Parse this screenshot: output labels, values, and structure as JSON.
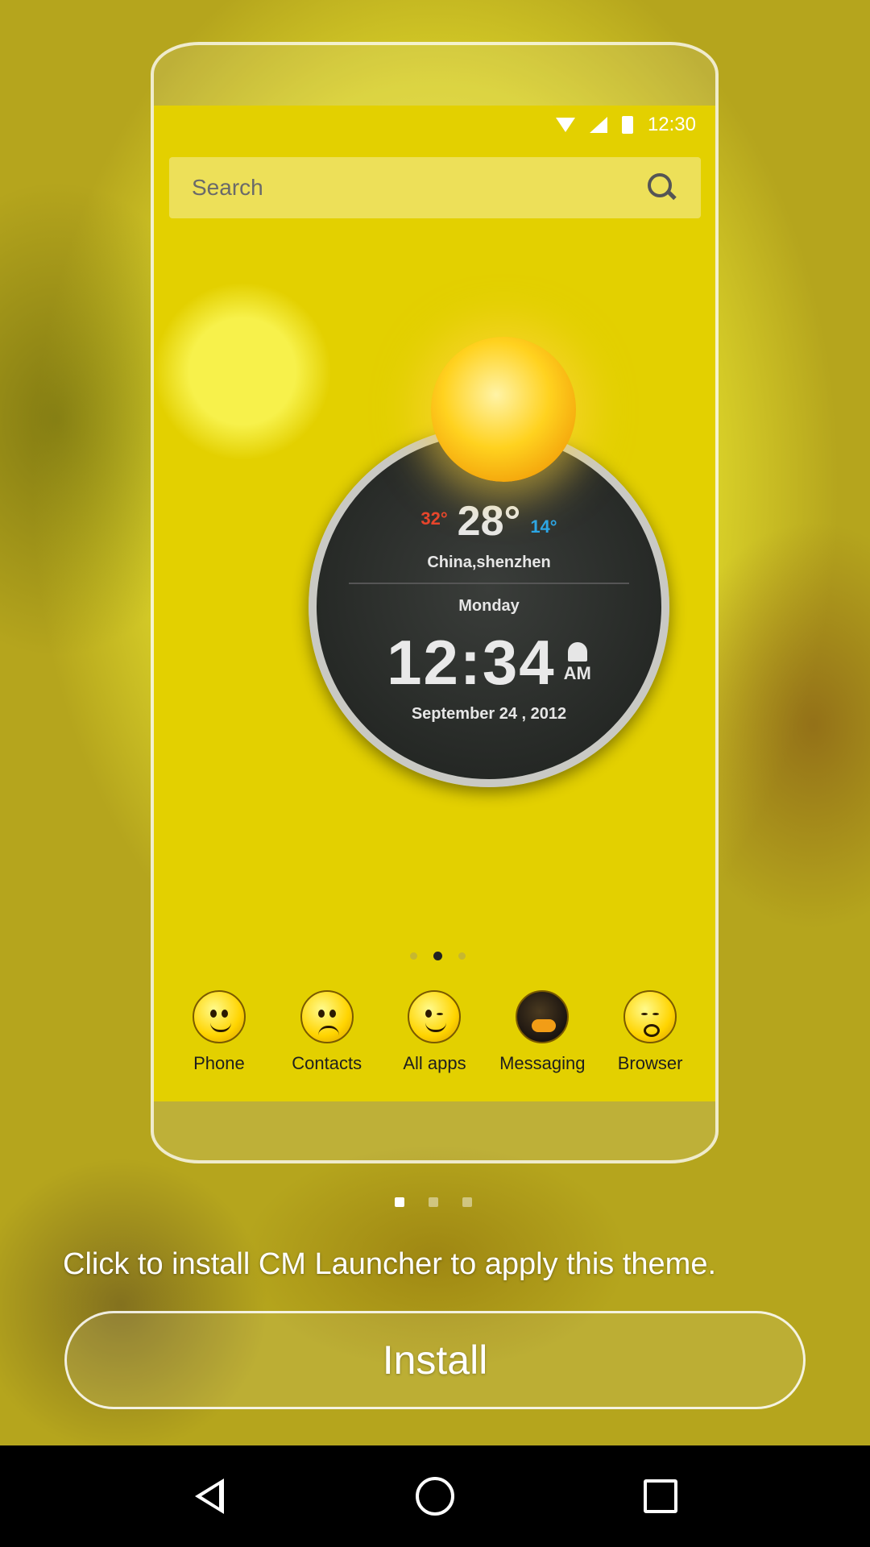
{
  "status_bar": {
    "time": "12:30"
  },
  "preview": {
    "search_placeholder": "Search",
    "weather_clock": {
      "temp_high": "32°",
      "temp_current": "28°",
      "temp_low": "14°",
      "location": "China,shenzhen",
      "day": "Monday",
      "time": "12:34",
      "ampm": "AM",
      "date": "September 24 , 2012"
    },
    "home_pages": {
      "count": 3,
      "active_index": 1
    },
    "dock": [
      {
        "label": "Phone",
        "icon": "smiley-icon"
      },
      {
        "label": "Contacts",
        "icon": "frown-emoji-icon"
      },
      {
        "label": "All apps",
        "icon": "wink-emoji-icon"
      },
      {
        "label": "Messaging",
        "icon": "bird-emoji-icon"
      },
      {
        "label": "Browser",
        "icon": "crying-emoji-icon"
      }
    ]
  },
  "pager": {
    "count": 3,
    "active_index": 0
  },
  "hint_text": "Click to install CM Launcher to apply this theme.",
  "install_label": "Install",
  "nav_bar": {
    "buttons": [
      "back-icon",
      "home-icon",
      "recents-icon"
    ]
  },
  "colors": {
    "accent": "#ffffff",
    "background": "#d9cc2a",
    "nav_bar": "#000000"
  }
}
